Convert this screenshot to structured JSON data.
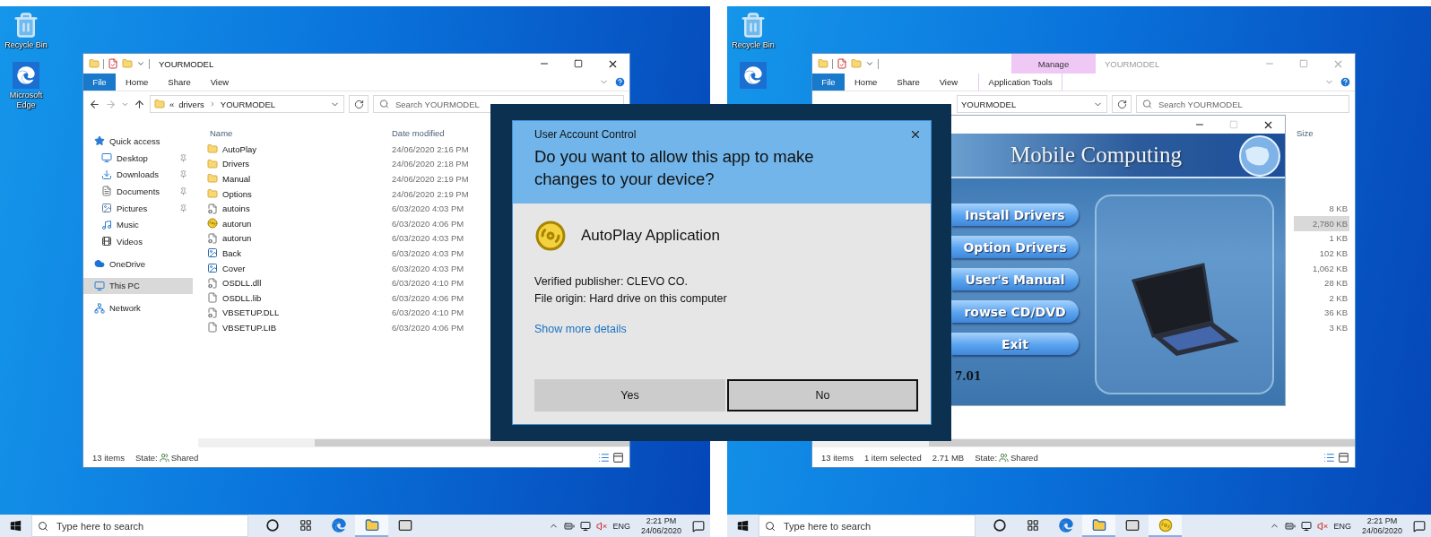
{
  "desktops": [
    {
      "icons": [
        {
          "kind": "recycle_bin",
          "label": "Recycle Bin"
        },
        {
          "kind": "edge",
          "label": "Microsoft Edge"
        }
      ],
      "taskbar": {
        "search_placeholder": "Type here to search",
        "apps": [
          {
            "kind": "cortana",
            "open": false
          },
          {
            "kind": "task_view",
            "open": false
          },
          {
            "kind": "edge",
            "open": false
          },
          {
            "kind": "explorer",
            "open": true
          },
          {
            "kind": "mail",
            "open": false
          }
        ],
        "language": "ENG",
        "time": "2:21 PM",
        "date": "24/06/2020"
      }
    },
    {
      "icons": [
        {
          "kind": "recycle_bin",
          "label": "Recycle Bin"
        },
        {
          "kind": "edge"
        }
      ],
      "taskbar": {
        "search_placeholder": "Type here to search",
        "apps": [
          {
            "kind": "cortana",
            "open": false
          },
          {
            "kind": "task_view",
            "open": false
          },
          {
            "kind": "edge",
            "open": false
          },
          {
            "kind": "explorer",
            "open": true
          },
          {
            "kind": "mail",
            "open": false
          },
          {
            "kind": "disc",
            "open": true
          }
        ],
        "language": "ENG",
        "time": "2:21 PM",
        "date": "24/06/2020"
      }
    }
  ],
  "explorer_left": {
    "title": "YOURMODEL",
    "active": true,
    "ribbon_tabs": [
      {
        "kind": "file",
        "label": "File"
      },
      {
        "kind": "tab",
        "label": "Home"
      },
      {
        "kind": "tab",
        "label": "Share"
      },
      {
        "kind": "tab",
        "label": "View"
      }
    ],
    "address": {
      "overflow": "«",
      "crumbs": [
        "drivers",
        "YOURMODEL"
      ]
    },
    "search_placeholder": "Search YOURMODEL",
    "nav": [
      {
        "kind": "quick_access",
        "label": "Quick access",
        "selected": false,
        "children": [
          {
            "kind": "desktop",
            "label": "Desktop",
            "pinned": true,
            "selected": false
          },
          {
            "kind": "downloads",
            "label": "Downloads",
            "pinned": true,
            "selected": false
          },
          {
            "kind": "documents",
            "label": "Documents",
            "pinned": true,
            "selected": false
          },
          {
            "kind": "pictures",
            "label": "Pictures",
            "pinned": true,
            "selected": false
          },
          {
            "kind": "music",
            "label": "Music",
            "pinned": false,
            "selected": false
          },
          {
            "kind": "videos",
            "label": "Videos",
            "pinned": false,
            "selected": false
          }
        ]
      },
      {
        "kind": "onedrive",
        "label": "OneDrive",
        "selected": false
      },
      {
        "kind": "pc",
        "label": "This PC",
        "selected": true
      },
      {
        "kind": "network",
        "label": "Network",
        "selected": false
      }
    ],
    "columns": [
      "Name",
      "Date modified"
    ],
    "files": [
      {
        "kind": "folder",
        "name": "AutoPlay",
        "date": "24/06/2020 2:16 PM"
      },
      {
        "kind": "folder",
        "name": "Drivers",
        "date": "24/06/2020 2:18 PM"
      },
      {
        "kind": "folder",
        "name": "Manual",
        "date": "24/06/2020 2:19 PM"
      },
      {
        "kind": "folder",
        "name": "Options",
        "date": "24/06/2020 2:19 PM"
      },
      {
        "kind": "settings",
        "name": "autoins",
        "date": "6/03/2020 4:03 PM"
      },
      {
        "kind": "disc",
        "name": "autorun",
        "date": "6/03/2020 4:06 PM"
      },
      {
        "kind": "settings",
        "name": "autorun",
        "date": "6/03/2020 4:03 PM"
      },
      {
        "kind": "image",
        "name": "Back",
        "date": "6/03/2020 4:03 PM"
      },
      {
        "kind": "image",
        "name": "Cover",
        "date": "6/03/2020 4:03 PM"
      },
      {
        "kind": "settings",
        "name": "OSDLL.dll",
        "date": "6/03/2020 4:10 PM"
      },
      {
        "kind": "file",
        "name": "OSDLL.lib",
        "date": "6/03/2020 4:06 PM"
      },
      {
        "kind": "settings",
        "name": "VBSETUP.DLL",
        "date": "6/03/2020 4:10 PM"
      },
      {
        "kind": "file",
        "name": "VBSETUP.LIB",
        "date": "6/03/2020 4:06 PM"
      }
    ],
    "status": {
      "count": "13 items",
      "state_label": "State:",
      "state_value": "Shared"
    }
  },
  "explorer_right": {
    "title": "YOURMODEL",
    "active": false,
    "contextual": {
      "header": "Manage",
      "label": "Application Tools"
    },
    "ribbon_tabs": [
      {
        "kind": "file",
        "label": "File"
      },
      {
        "kind": "tab",
        "label": "Home"
      },
      {
        "kind": "tab",
        "label": "Share"
      },
      {
        "kind": "tab",
        "label": "View"
      }
    ],
    "address": {
      "crumbs": [
        "YOURMODEL"
      ]
    },
    "search_placeholder": "Search YOURMODEL",
    "columns": [
      "Size"
    ],
    "sizes": [
      {
        "size": "8 KB",
        "selected": false
      },
      {
        "size": "2,780 KB",
        "selected": true
      },
      {
        "size": "1 KB",
        "selected": false
      },
      {
        "size": "102 KB",
        "selected": false
      },
      {
        "size": "1,062 KB",
        "selected": false
      },
      {
        "size": "28 KB",
        "selected": false
      },
      {
        "size": "2 KB",
        "selected": false
      },
      {
        "size": "36 KB",
        "selected": false
      },
      {
        "size": "3 KB",
        "selected": false
      }
    ],
    "status": {
      "count": "13 items",
      "selection": "1 item selected",
      "selection_size": "2.71 MB",
      "state_label": "State:",
      "state_value": "Shared"
    }
  },
  "autoplay_window": {
    "maximize_enabled": false,
    "banner_title": "Mobile Computing",
    "menu": [
      "Install Drivers",
      "Option Drivers",
      "User's Manual",
      "rowse CD/DVD",
      "Exit"
    ],
    "version": "7.01"
  },
  "uac_dialog": {
    "header": "User Account Control",
    "question": "Do you want to allow this app to make changes to your device?",
    "app_name": "AutoPlay Application",
    "publisher": "Verified publisher: CLEVO CO.",
    "origin": "File origin: Hard drive on this computer",
    "details_link": "Show more details",
    "buttons": [
      {
        "label": "Yes",
        "focused": false
      },
      {
        "label": "No",
        "focused": true
      }
    ]
  }
}
